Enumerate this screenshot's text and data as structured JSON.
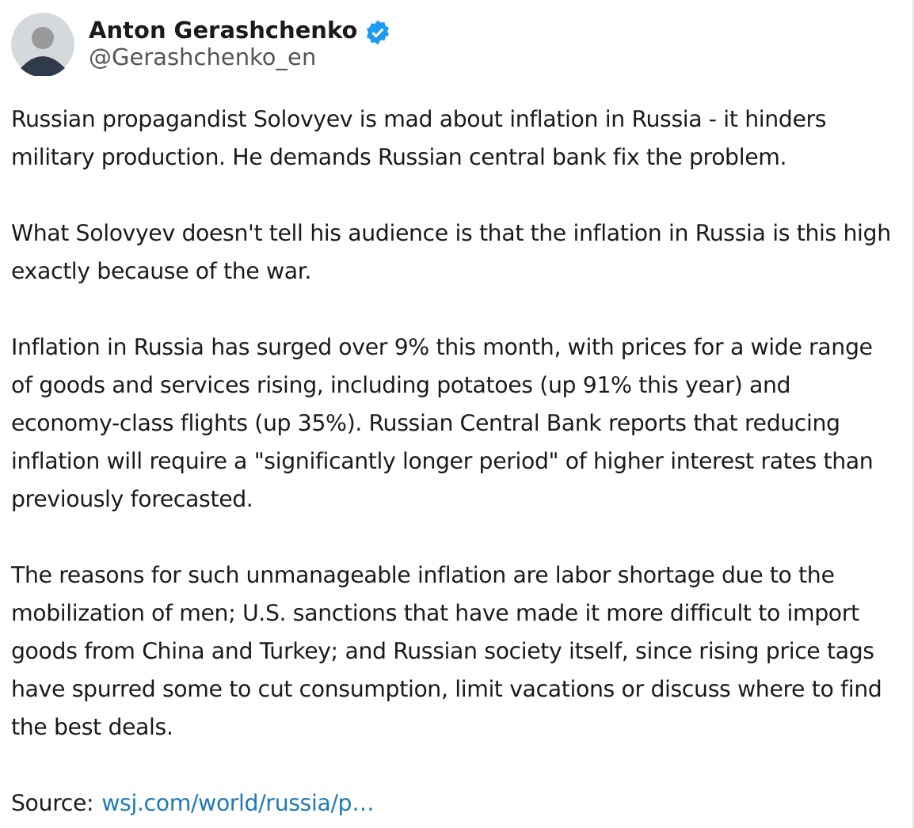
{
  "author": {
    "name": "Anton Gerashchenko",
    "handle": "@Gerashchenko_en",
    "verified": true
  },
  "paragraphs": [
    "Russian propagandist Solovyev is mad about inflation in Russia - it hinders military production. He demands Russian central bank fix the problem.",
    "What Solovyev doesn't tell his audience is that the inflation in Russia is this high exactly because of the war.",
    "Inflation in Russia has surged over 9% this month, with prices for a wide range of goods and services rising, including potatoes (up 91% this year) and economy-class flights (up 35%). Russian Central Bank reports that reducing inflation will require a \"significantly longer period\" of higher interest rates than previously forecasted.",
    "The reasons for such unmanageable inflation are labor shortage due to the mobilization of men; U.S. sanctions that have made it more difficult to import goods from China and Turkey; and Russian society itself, since rising price tags have spurred some to cut consumption, limit vacations or discuss where to find the best deals."
  ],
  "source": {
    "label": "Source:",
    "link": "wsj.com/world/russia/p…"
  }
}
